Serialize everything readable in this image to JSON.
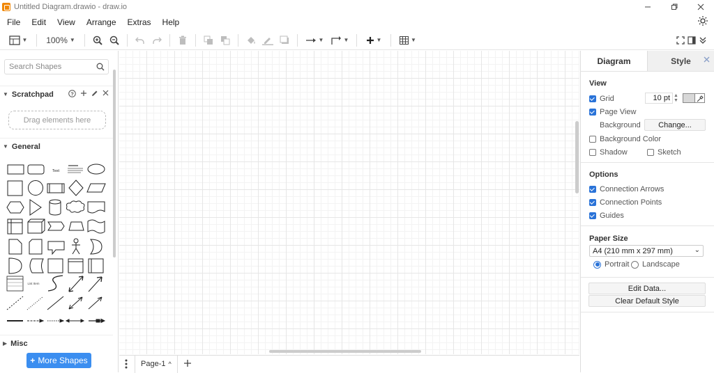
{
  "window": {
    "title": "Untitled Diagram.drawio - draw.io",
    "controls": [
      "minimize",
      "maximize",
      "close"
    ]
  },
  "menu": {
    "items": [
      "File",
      "Edit",
      "View",
      "Arrange",
      "Extras",
      "Help"
    ]
  },
  "toolbar": {
    "zoom": "100%"
  },
  "sidebar": {
    "search_placeholder": "Search Shapes",
    "scratchpad": {
      "title": "Scratchpad",
      "drop_hint": "Drag elements here"
    },
    "general": {
      "title": "General",
      "text_shape_label": "Text",
      "list_item_label": "List Item"
    },
    "misc": {
      "title": "Misc"
    },
    "more_shapes": "More Shapes"
  },
  "pages": {
    "current": "Page-1"
  },
  "format_panel": {
    "tabs": [
      "Diagram",
      "Style"
    ],
    "view": {
      "title": "View",
      "grid_label": "Grid",
      "grid_checked": true,
      "grid_size": "10 pt",
      "grid_color": "#d8d8d8",
      "page_view_label": "Page View",
      "page_view_checked": true,
      "background_label": "Background",
      "change_button": "Change...",
      "background_color_label": "Background Color",
      "shadow_label": "Shadow",
      "sketch_label": "Sketch"
    },
    "options": {
      "title": "Options",
      "connection_arrows": "Connection Arrows",
      "connection_points": "Connection Points",
      "guides": "Guides"
    },
    "paper": {
      "title": "Paper Size",
      "size": "A4 (210 mm x 297 mm)",
      "portrait": "Portrait",
      "landscape": "Landscape",
      "orientation": "portrait"
    },
    "edit_data": "Edit Data...",
    "clear_default_style": "Clear Default Style"
  },
  "colors": {
    "accent": "#2a73d8",
    "more_shapes_bg": "#3b8ef0",
    "app_icon": "#f08705"
  }
}
